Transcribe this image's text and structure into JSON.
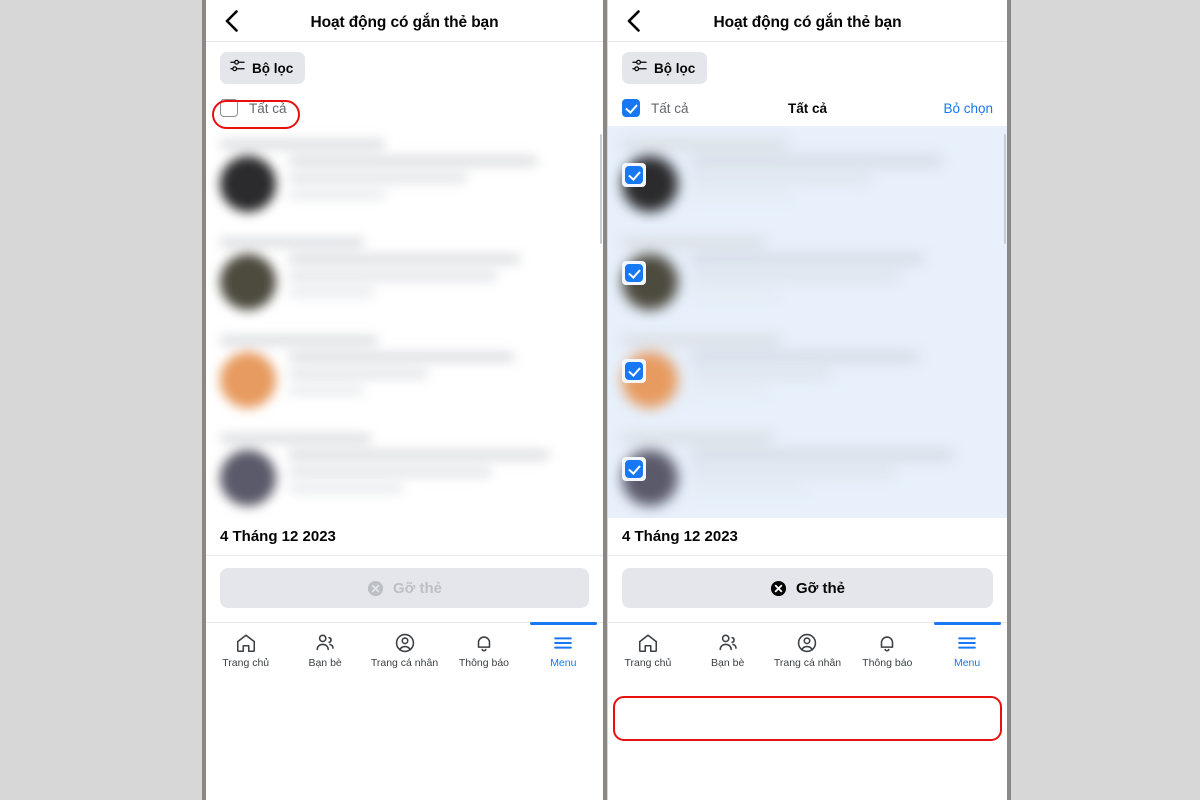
{
  "meta": {
    "background_color": "#d7d7d7",
    "accent_color": "#1877f2",
    "annotation_color": "#e8100f",
    "chip_bg": "#e4e6eb",
    "selected_row_bg": "#e7f0fb"
  },
  "screens": [
    {
      "id": "left",
      "state_name": "none-selected",
      "header": {
        "back_icon": "chevron-left-icon",
        "title": "Hoạt động có gắn thẻ bạn"
      },
      "filter": {
        "icon": "sliders-icon",
        "label": "Bộ lọc"
      },
      "select_all": {
        "checked": false,
        "label": "Tất cả",
        "center_label": "",
        "action_label": "",
        "show_center": false,
        "show_action": false
      },
      "rows": [
        {
          "checked": false,
          "avatar_color": "#2b2b2d",
          "title_width": "46%",
          "line_widths": [
            "86%",
            "62%"
          ]
        },
        {
          "checked": false,
          "avatar_color": "#4d4a3e",
          "title_width": "40%",
          "line_widths": [
            "80%",
            "72%"
          ]
        },
        {
          "checked": false,
          "avatar_color": "#e79b60",
          "title_width": "44%",
          "line_widths": [
            "78%",
            "48%"
          ]
        },
        {
          "checked": false,
          "avatar_color": "#5b5a6a",
          "title_width": "42%",
          "line_widths": [
            "90%",
            "70%"
          ]
        }
      ],
      "date_label": "4 Tháng 12 2023",
      "action_button": {
        "label": "Gỡ thẻ",
        "icon": "circle-x-icon",
        "enabled": false,
        "annotated": false
      },
      "nav": {
        "items": [
          {
            "icon": "home-icon",
            "label": "Trang chủ",
            "active": false
          },
          {
            "icon": "friends-icon",
            "label": "Bạn bè",
            "active": false
          },
          {
            "icon": "profile-icon",
            "label": "Trang cá nhân",
            "active": false
          },
          {
            "icon": "notifications-icon",
            "label": "Thông báo",
            "active": false
          },
          {
            "icon": "menu-icon",
            "label": "Menu",
            "active": true
          }
        ]
      }
    },
    {
      "id": "right",
      "state_name": "all-selected",
      "header": {
        "back_icon": "chevron-left-icon",
        "title": "Hoạt động có gắn thẻ bạn"
      },
      "filter": {
        "icon": "sliders-icon",
        "label": "Bộ lọc"
      },
      "select_all": {
        "checked": true,
        "label": "Tất cả",
        "center_label": "Tất cả",
        "action_label": "Bỏ chọn",
        "show_center": true,
        "show_action": true
      },
      "rows": [
        {
          "checked": true,
          "avatar_color": "#2b2b2d",
          "title_width": "46%",
          "line_widths": [
            "86%",
            "62%"
          ]
        },
        {
          "checked": true,
          "avatar_color": "#4d4a3e",
          "title_width": "40%",
          "line_widths": [
            "80%",
            "72%"
          ]
        },
        {
          "checked": true,
          "avatar_color": "#e79b60",
          "title_width": "44%",
          "line_widths": [
            "78%",
            "48%"
          ]
        },
        {
          "checked": true,
          "avatar_color": "#5b5a6a",
          "title_width": "42%",
          "line_widths": [
            "90%",
            "70%"
          ]
        }
      ],
      "date_label": "4 Tháng 12 2023",
      "action_button": {
        "label": "Gỡ thẻ",
        "icon": "circle-x-icon",
        "enabled": true,
        "annotated": true
      },
      "nav": {
        "items": [
          {
            "icon": "home-icon",
            "label": "Trang chủ",
            "active": false
          },
          {
            "icon": "friends-icon",
            "label": "Bạn bè",
            "active": false
          },
          {
            "icon": "profile-icon",
            "label": "Trang cá nhân",
            "active": false
          },
          {
            "icon": "notifications-icon",
            "label": "Thông báo",
            "active": false
          },
          {
            "icon": "menu-icon",
            "label": "Menu",
            "active": true
          }
        ]
      }
    }
  ],
  "annotations": [
    {
      "name": "select-all-highlight",
      "target": "left.select-all-checkbox"
    },
    {
      "name": "remove-tag-highlight",
      "target": "right.remove-tag-button"
    }
  ]
}
